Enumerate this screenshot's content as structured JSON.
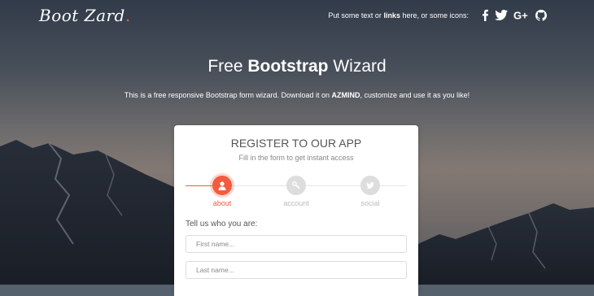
{
  "logo": {
    "text": "Boot Zard",
    "dot": "."
  },
  "topnav": {
    "text_before": "Put some text or ",
    "link": "links",
    "text_after": " here, or some icons:",
    "icons": [
      "facebook-icon",
      "twitter-icon",
      "google-plus-icon",
      "github-icon"
    ]
  },
  "hero": {
    "title_pre": "Free ",
    "title_bold": "Bootstrap",
    "title_post": " Wizard",
    "subtitle_pre": "This is a free responsive Bootstrap form wizard. Download it on ",
    "subtitle_bold": "AZMIND",
    "subtitle_post": ", customize and use it as you like!"
  },
  "card": {
    "title": "REGISTER TO OUR APP",
    "subtitle": "Fill in the form to get instant access",
    "steps": [
      {
        "label": "about",
        "icon": "user-icon",
        "active": true
      },
      {
        "label": "account",
        "icon": "key-icon",
        "active": false
      },
      {
        "label": "social",
        "icon": "twitter-icon",
        "active": false
      }
    ],
    "form_heading": "Tell us who you are:",
    "fields": {
      "first_name": {
        "placeholder": "First name...",
        "value": ""
      },
      "last_name": {
        "placeholder": "Last name...",
        "value": ""
      }
    }
  },
  "colors": {
    "accent": "#f35b3f",
    "inactive_step": "#dddddd",
    "card_bg": "#ffffff",
    "text_white": "#ffffff"
  }
}
